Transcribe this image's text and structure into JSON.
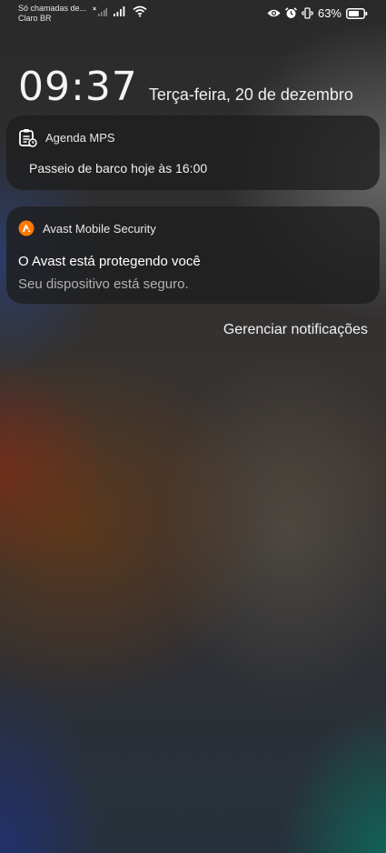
{
  "status_bar": {
    "notice": "Só chamadas de...",
    "carrier": "Claro BR",
    "battery_percent": "63%",
    "icons": [
      "signal-x-icon",
      "signal-icon",
      "wifi-icon",
      "eye-icon",
      "alarm-icon",
      "vibrate-icon",
      "battery-icon"
    ]
  },
  "lockscreen": {
    "time": "09:37",
    "date": "Terça-feira, 20 de dezembro"
  },
  "notifications": [
    {
      "app": "Agenda MPS",
      "icon": "calendar-note-icon",
      "body": "Passeio de barco hoje às 16:00"
    },
    {
      "app": "Avast Mobile Security",
      "icon": "avast-logo-icon",
      "title": "O Avast está protegendo você",
      "text": "Seu dispositivo está seguro."
    }
  ],
  "manage_label": "Gerenciar notificações",
  "colors": {
    "avast_orange": "#ff7800",
    "card_bg": "#1e1e1e"
  }
}
